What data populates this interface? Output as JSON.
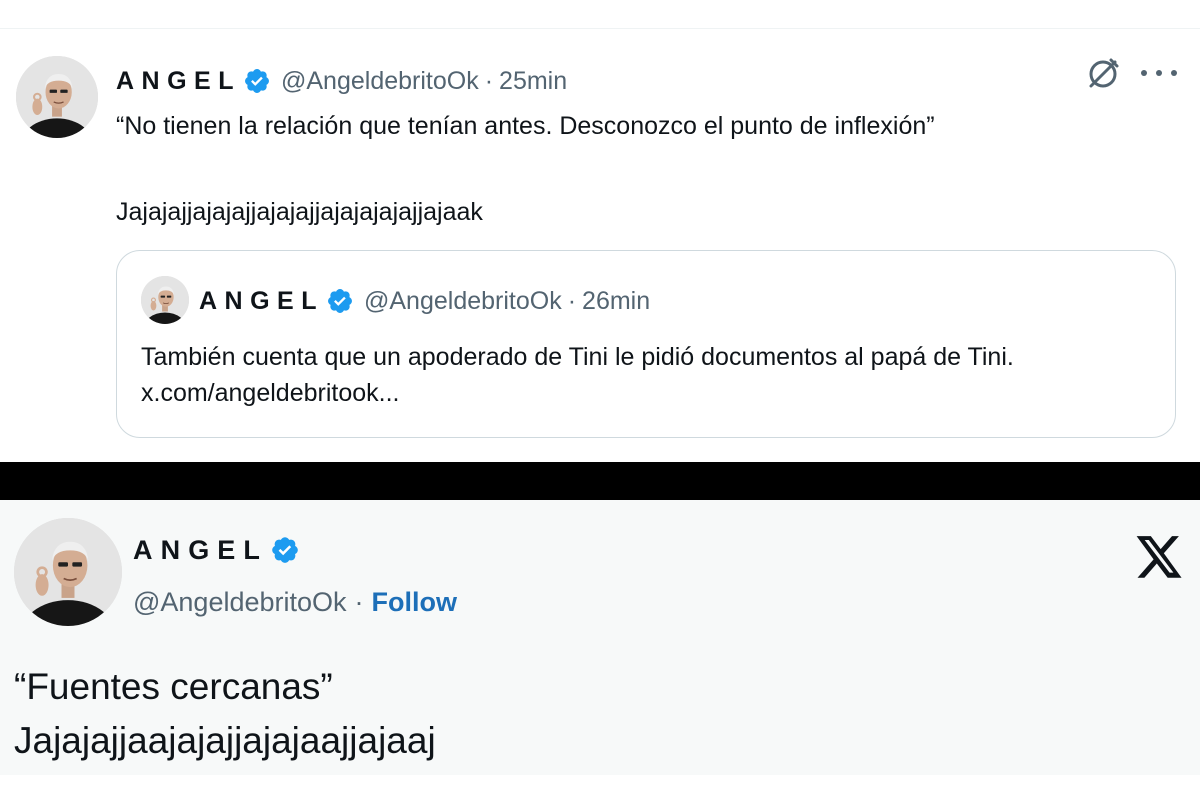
{
  "tweet_main": {
    "author_name": "ANGEL",
    "handle": "@AngeldebritoOk",
    "separator": "·",
    "time": "25min",
    "text_line1": "“No tienen la relación que tenían antes. Desconozco el punto de inflexión”",
    "text_line2": "Jajajajjajajajjajajajjajajajajajjajaak",
    "icons": [
      "grok-icon",
      "more-options-icon",
      "verified-badge-icon"
    ]
  },
  "quoted_tweet": {
    "author_name": "ANGEL",
    "handle": "@AngeldebritoOk",
    "separator": "·",
    "time": "26min",
    "text": "También cuenta que un apoderado de Tini le pidió documentos al papá de Tini. x.com/angeldebritook..."
  },
  "embedded_tweet": {
    "author_name": "ANGEL",
    "handle": "@AngeldebritoOk",
    "separator": "·",
    "follow_label": "Follow",
    "text_line1": "“Fuentes cercanas”",
    "text_line2": "Jajajajjaajajajjajajaajjajaaj",
    "icons": [
      "x-logo-icon",
      "verified-badge-icon"
    ]
  },
  "colors": {
    "verified": "#1d9bf0",
    "follow": "#1d6fb8",
    "secondary_text": "#536471",
    "divider": "#000000",
    "embed_background": "#f7f9f9"
  }
}
